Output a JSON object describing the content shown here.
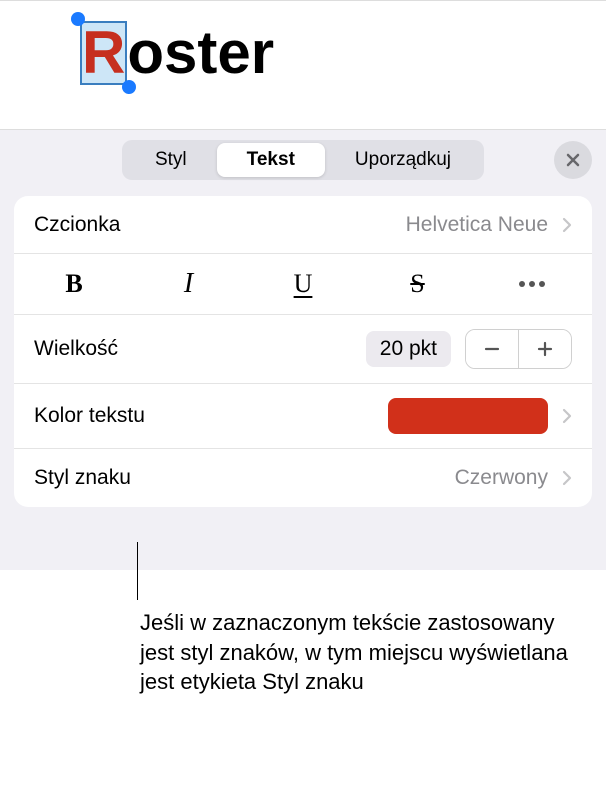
{
  "editor": {
    "selected_text": "R",
    "rest_text": "oster"
  },
  "tabs": {
    "style": "Styl",
    "text": "Tekst",
    "arrange": "Uporządkuj"
  },
  "font": {
    "label": "Czcionka",
    "value": "Helvetica Neue"
  },
  "format_buttons": {
    "bold": "B",
    "italic": "I",
    "underline": "U",
    "strike": "S"
  },
  "size": {
    "label": "Wielkość",
    "value": "20 pkt"
  },
  "text_color": {
    "label": "Kolor tekstu",
    "hex": "#d1301a"
  },
  "char_style": {
    "label": "Styl znaku",
    "value": "Czerwony"
  },
  "callout": "Jeśli w zaznaczonym tekście zastosowany jest styl znaków, w tym miejscu wyświetlana jest etykieta Styl znaku"
}
